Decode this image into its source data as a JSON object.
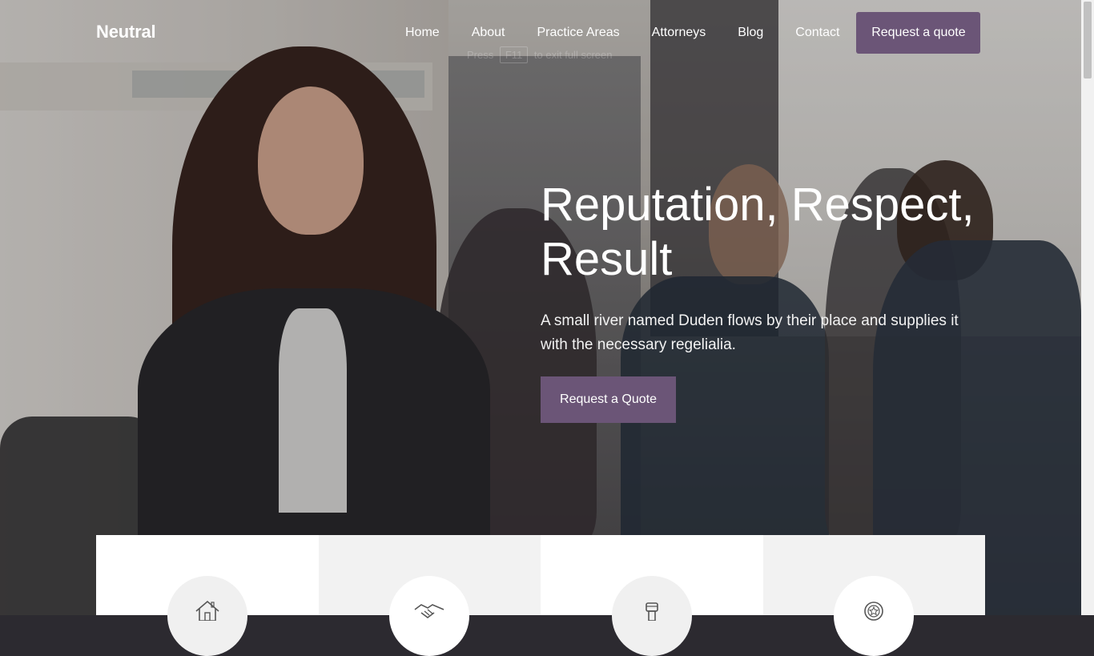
{
  "brand": {
    "name": "Neutral"
  },
  "nav": {
    "items": [
      {
        "label": "Home"
      },
      {
        "label": "About"
      },
      {
        "label": "Practice Areas"
      },
      {
        "label": "Attorneys"
      },
      {
        "label": "Blog"
      },
      {
        "label": "Contact"
      }
    ],
    "cta_label": "Request a quote"
  },
  "fullscreen_hint": {
    "before": "Press",
    "key": "F11",
    "after": "to exit full screen"
  },
  "hero": {
    "title": "Reputation, Respect, Result",
    "subtitle": "A small river named Duden flows by their place and supplies it with the necessary regelialia.",
    "button_label": "Request a Quote"
  },
  "feature_cards": [
    {
      "icon": "house-icon"
    },
    {
      "icon": "handshake-icon"
    },
    {
      "icon": "gavel-icon"
    },
    {
      "icon": "award-badge-icon"
    }
  ],
  "colors": {
    "accent": "#6b5577",
    "card_light": "#ffffff",
    "card_grey": "#f2f2f2"
  }
}
